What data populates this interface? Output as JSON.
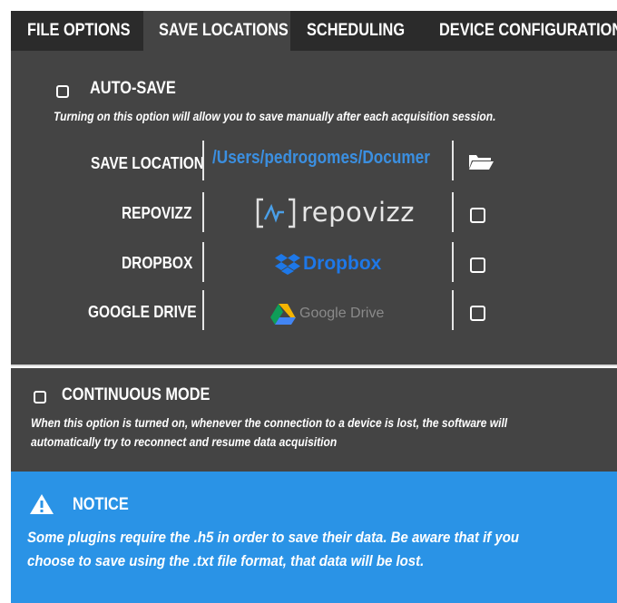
{
  "tabs": [
    {
      "label": "FILE OPTIONS",
      "active": false
    },
    {
      "label": "SAVE LOCATIONS",
      "active": true
    },
    {
      "label": "SCHEDULING",
      "active": false
    },
    {
      "label": "DEVICE CONFIGURATION",
      "active": false
    }
  ],
  "autosave": {
    "label": "AUTO-SAVE",
    "checked": false,
    "description": "Turning on this option will allow you to save manually after each acquisition session."
  },
  "save_location": {
    "label": "SAVE LOCATION",
    "path": "/Users/pedrogomes/Documer",
    "icon": "folder-open-icon"
  },
  "services": [
    {
      "label": "REPOVIZZ",
      "logo_text": "repovizz",
      "checked": false
    },
    {
      "label": "DROPBOX",
      "logo_text": "Dropbox",
      "checked": false
    },
    {
      "label": "GOOGLE DRIVE",
      "logo_text": "Google Drive",
      "checked": false
    }
  ],
  "continuous": {
    "label": "CONTINUOUS MODE",
    "checked": false,
    "description_line1": "When this option is turned on, whenever the connection to a device is lost, the software will",
    "description_line2": "automatically try to reconnect and resume data acquisition"
  },
  "notice": {
    "title": "NOTICE",
    "line1": "Some plugins require the .h5 in order to save their data. Be aware that if you",
    "line2": "choose to save using the .txt file format, that data will be lost."
  },
  "colors": {
    "panel": "#444444",
    "tabbar": "#2b2b2b",
    "accent_blue": "#3b8fe0",
    "notice": "#2a93e6"
  }
}
